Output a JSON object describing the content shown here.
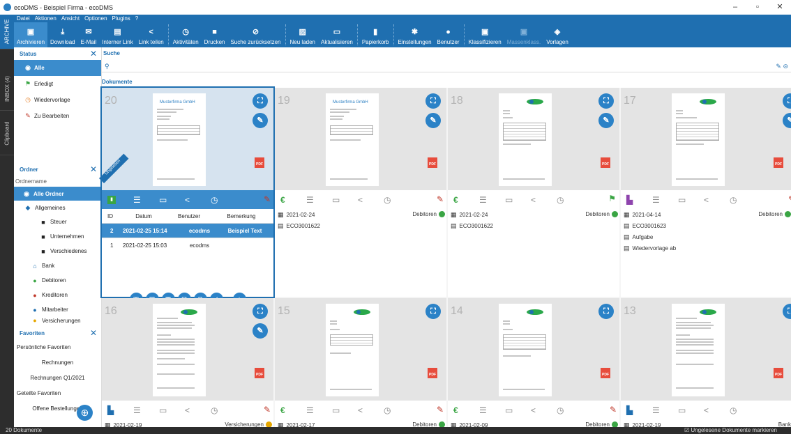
{
  "window": {
    "title": "ecoDMS - Beispiel Firma - ecoDMS"
  },
  "menu": [
    "Datei",
    "Aktionen",
    "Ansicht",
    "Optionen",
    "Plugins",
    "?"
  ],
  "toolbar": {
    "group1": [
      "Archivieren",
      "Download",
      "E-Mail",
      "Interner Link",
      "Link teilen"
    ],
    "group2": [
      "Aktivitäten",
      "Drucken",
      "Suche zurücksetzen"
    ],
    "group3": [
      "Neu laden",
      "Aktualisieren"
    ],
    "group4": [
      "Papierkorb"
    ],
    "group5": [
      "Einstellungen",
      "Benutzer"
    ],
    "group6": [
      "Klassifizieren",
      "Massenklass.",
      "Vorlagen"
    ]
  },
  "sidetabs": [
    "ARCHIVE",
    "INBOX (4)",
    "Clipboard"
  ],
  "status_panel": {
    "title": "Status",
    "items": [
      {
        "label": "Alle",
        "icon": "all-icon"
      },
      {
        "label": "Erledigt",
        "icon": "flag-icon"
      },
      {
        "label": "Wiedervorlage",
        "icon": "clock-icon"
      },
      {
        "label": "Zu Bearbeiten",
        "icon": "pencil-icon"
      }
    ]
  },
  "folder_panel": {
    "title": "Ordner",
    "column": "Ordnername",
    "items": [
      {
        "label": "Alle Ordner"
      },
      {
        "label": "Allgemeines"
      },
      {
        "label": "Steuer"
      },
      {
        "label": "Unternehmen"
      },
      {
        "label": "Verschiedenes"
      },
      {
        "label": "Bank"
      },
      {
        "label": "Debitoren"
      },
      {
        "label": "Kreditoren"
      },
      {
        "label": "Mitarbeiter"
      },
      {
        "label": "Versicherungen"
      }
    ]
  },
  "favorites_panel": {
    "title": "Favoriten",
    "personal": "Persönliche Favoriten",
    "items": [
      "Rechnungen",
      "Rechnungen Q1/2021"
    ],
    "shared": "Geteilte Favoriten",
    "shared_items": [
      "Offene Bestellungen"
    ]
  },
  "search": {
    "label": "Suche"
  },
  "documents_label": "Dokumente",
  "cards": [
    {
      "num": "20",
      "company": "Musterfirma GmbH",
      "ribbon": "Ungelesen"
    },
    {
      "num": "19",
      "company": "Musterfirma GmbH",
      "date": "2021-02-24",
      "id": "ECO3001622",
      "folder": "Debitoren"
    },
    {
      "num": "18",
      "date": "2021-02-24",
      "id": "ECO3001622",
      "folder": "Debitoren"
    },
    {
      "num": "17",
      "date": "2021-04-14",
      "id": "ECO3001623",
      "extra1": "Aufgabe",
      "extra2": "Wiedervorlage ab",
      "folder": "Debitoren"
    },
    {
      "num": "16",
      "date": "2021-02-19",
      "folder": "Versicherungen"
    },
    {
      "num": "15",
      "date": "2021-02-17",
      "folder": "Debitoren"
    },
    {
      "num": "14",
      "date": "2021-02-09",
      "folder": "Debitoren"
    },
    {
      "num": "13",
      "date": "2021-02-19",
      "folder": "Bank"
    }
  ],
  "history": {
    "headers": [
      "ID",
      "Datum",
      "Benutzer",
      "Bemerkung"
    ],
    "rows": [
      [
        "2",
        "2021-02-25 15:14",
        "ecodms",
        "Beispiel Text"
      ],
      [
        "1",
        "2021-02-25 15:03",
        "ecodms",
        ""
      ]
    ]
  },
  "statusbar": {
    "count": "20 Dokumente",
    "checkbox": "Ungelesene Dokumente markieren"
  },
  "pdf": "PDF"
}
